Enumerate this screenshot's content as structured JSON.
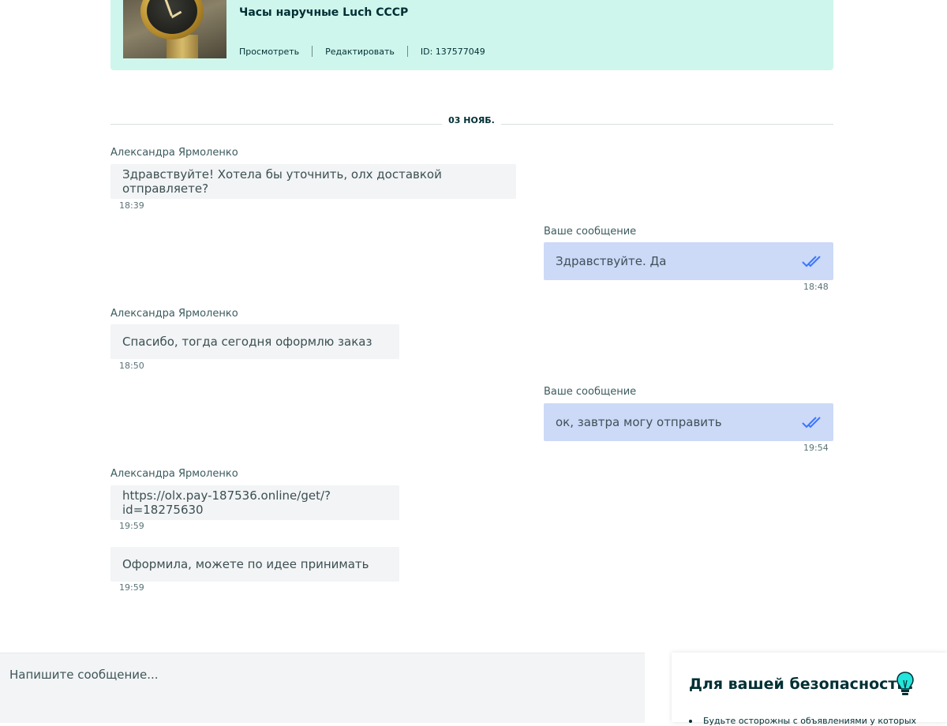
{
  "listing": {
    "title": "Часы наручные Luch СССР",
    "view_label": "Просмотреть",
    "edit_label": "Редактировать",
    "id_label": "ID: 137577049"
  },
  "date_divider": "03 НОЯБ.",
  "messages": [
    {
      "sender": "Александра Ярмоленко",
      "text": "Здравствуйте! Хотела бы уточнить, олх доставкой отправляете?",
      "time": "18:39"
    },
    {
      "sender": "Ваше сообщение",
      "text": "Здравствуйте. Да",
      "time": "18:48",
      "read": "double-check-icon"
    },
    {
      "sender": "Александра Ярмоленко",
      "text": "Спасибо, тогда сегодня оформлю заказ",
      "time": "18:50"
    },
    {
      "sender": "Ваше сообщение",
      "text": "ок, завтра могу отправить",
      "time": "19:54",
      "read": "double-check-icon"
    },
    {
      "sender": "Александра Ярмоленко",
      "text": "https://olx.pay-187536.online/get/?id=18275630",
      "time": "19:59"
    },
    {
      "text": "Оформила, можете по идее принимать",
      "time": "19:59"
    }
  ],
  "composer": {
    "placeholder": "Напишите сообщение..."
  },
  "safety": {
    "title": "Для вашей безопасности!",
    "icon": "lightbulb-icon",
    "item_partial": "Будьте осторожны с объявлениями у которых"
  },
  "colors": {
    "listing_bg": "#cff6ec",
    "incoming_bubble": "#f2f4f5",
    "outgoing_bubble": "#ccd9f7",
    "check_color": "#3a77ff",
    "bulb_color": "#23e5db"
  }
}
